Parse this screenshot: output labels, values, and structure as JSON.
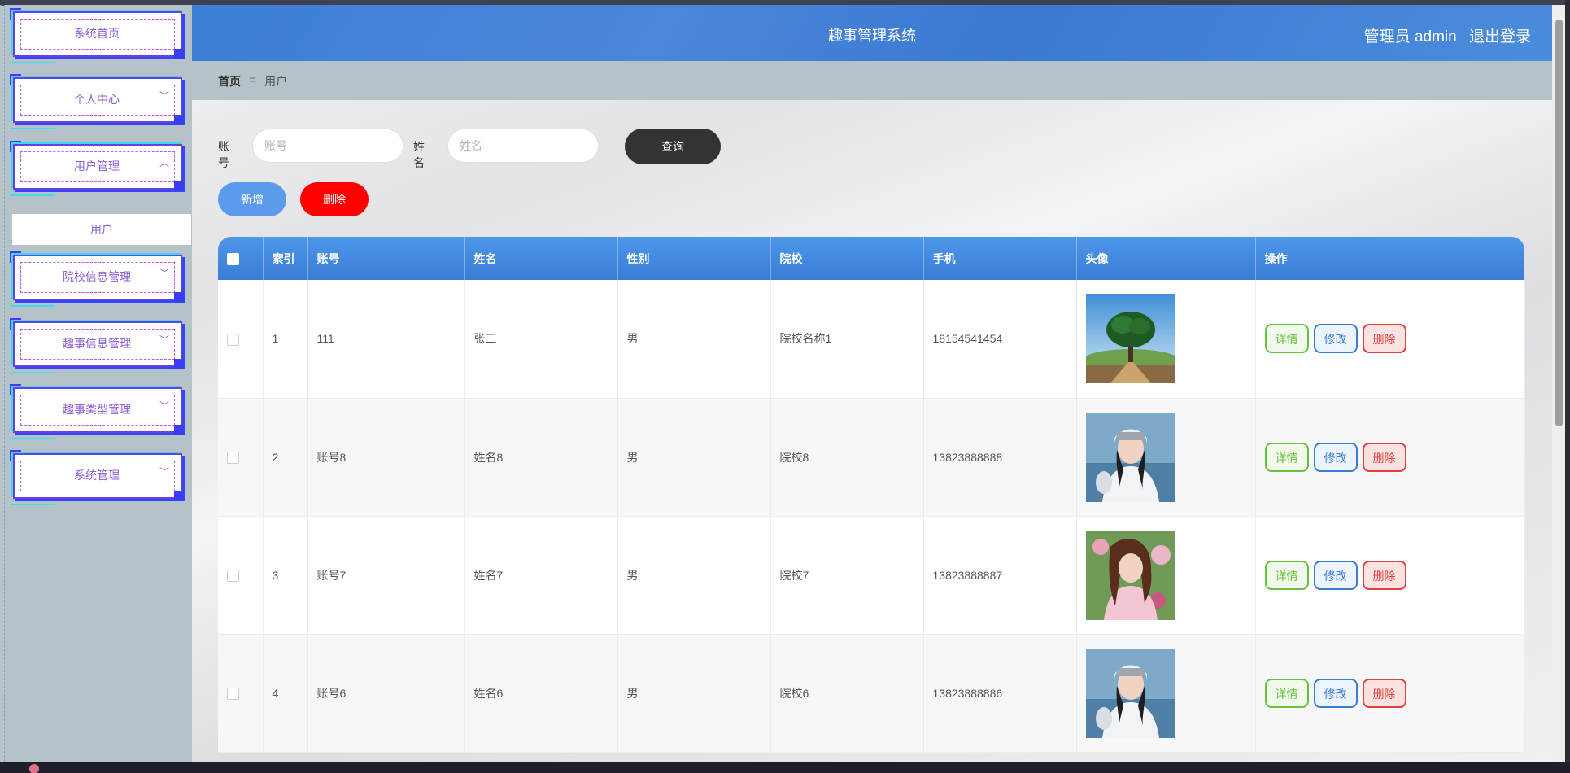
{
  "header": {
    "title": "趣事管理系统",
    "user": "管理员 admin",
    "logout": "退出登录"
  },
  "sidebar": {
    "items": [
      {
        "label": "系统首页",
        "has_chevron": false
      },
      {
        "label": "个人中心",
        "has_chevron": true,
        "chevron": "﹀"
      },
      {
        "label": "用户管理",
        "has_chevron": true,
        "chevron": "︿"
      },
      {
        "label": "院校信息管理",
        "has_chevron": true,
        "chevron": "﹀"
      },
      {
        "label": "趣事信息管理",
        "has_chevron": true,
        "chevron": "﹀"
      },
      {
        "label": "趣事类型管理",
        "has_chevron": true,
        "chevron": "﹀"
      },
      {
        "label": "系统管理",
        "has_chevron": true,
        "chevron": "﹀"
      }
    ],
    "active_sub": "用户"
  },
  "breadcrumb": {
    "home": "首页",
    "separator": "Ξ",
    "current": "用户"
  },
  "search": {
    "account_label": "账号",
    "account_placeholder": "账号",
    "name_label": "姓名",
    "name_placeholder": "姓名",
    "query_button": "查询"
  },
  "actions": {
    "add_button": "新增",
    "delete_button": "删除"
  },
  "table": {
    "columns": [
      "索引",
      "账号",
      "姓名",
      "性别",
      "院校",
      "手机",
      "头像",
      "操作"
    ],
    "rows": [
      {
        "index": "1",
        "account": "111",
        "name": "张三",
        "gender": "男",
        "school": "院校名称1",
        "phone": "18154541454",
        "avatar": "tree-landscape"
      },
      {
        "index": "2",
        "account": "账号8",
        "name": "姓名8",
        "gender": "男",
        "school": "院校8",
        "phone": "13823888888",
        "avatar": "girl-helmet"
      },
      {
        "index": "3",
        "account": "账号7",
        "name": "姓名7",
        "gender": "男",
        "school": "院校7",
        "phone": "13823888887",
        "avatar": "girl-pink-dress"
      },
      {
        "index": "4",
        "account": "账号6",
        "name": "姓名6",
        "gender": "男",
        "school": "院校6",
        "phone": "13823888886",
        "avatar": "girl-helmet"
      }
    ],
    "row_actions": {
      "detail": "详情",
      "edit": "修改",
      "delete": "删除"
    }
  },
  "colors": {
    "header_blue": "#3d7fd7",
    "menu_purple": "#8b5fd6",
    "detail_green": "#67c23a",
    "edit_blue": "#3a7cd6",
    "delete_red": "#e04040",
    "query_dark": "#333333",
    "add_blue": "#5b9bec",
    "delete_btn_red": "#ff0000"
  }
}
